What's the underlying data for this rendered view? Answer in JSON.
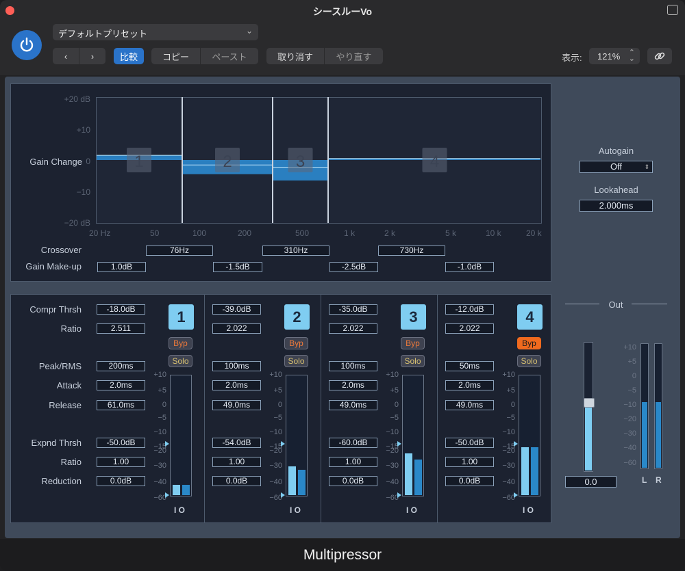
{
  "window": {
    "title": "シースルーVo"
  },
  "header": {
    "preset": "デフォルトプリセット",
    "compare_label": "比較",
    "copy_label": "コピー",
    "paste_label": "ペースト",
    "undo_label": "取り消す",
    "redo_label": "やり直す",
    "view_label": "表示:",
    "zoom": "121%"
  },
  "graph": {
    "ylabel": "Gain Change",
    "y_ticks": [
      "+20 dB",
      "+10",
      "0",
      "−10",
      "−20 dB"
    ],
    "x_ticks": [
      "20 Hz",
      "50",
      "100",
      "200",
      "500",
      "1 k",
      "2 k",
      "5 k",
      "10 k",
      "20 k"
    ],
    "band_gain_db": [
      1.5,
      -4.5,
      -6.5,
      0.5
    ],
    "band_labels": [
      "1",
      "2",
      "3",
      "4"
    ]
  },
  "crossover": {
    "label": "Crossover",
    "values": [
      "76Hz",
      "310Hz",
      "730Hz"
    ]
  },
  "gain_makeup": {
    "label": "Gain Make-up",
    "values": [
      "1.0dB",
      "-1.5dB",
      "-2.5dB",
      "-1.0dB"
    ]
  },
  "side": {
    "autogain_label": "Autogain",
    "autogain_value": "Off",
    "lookahead_label": "Lookahead",
    "lookahead_value": "2.000ms"
  },
  "row_labels": {
    "compr_thrsh": "Compr Thrsh",
    "ratio": "Ratio",
    "peak_rms": "Peak/RMS",
    "attack": "Attack",
    "release": "Release",
    "expnd_thrsh": "Expnd Thrsh",
    "ratio2": "Ratio",
    "reduction": "Reduction"
  },
  "bands": [
    {
      "num": "1",
      "compr_thrsh": "-18.0dB",
      "ratio": "2.511",
      "peak_rms": "200ms",
      "attack": "2.0ms",
      "release": "61.0ms",
      "expnd_thrsh": "-50.0dB",
      "expnd_ratio": "1.00",
      "reduction": "0.0dB",
      "byp": "Byp",
      "solo": "Solo",
      "byp_on": false,
      "meter_in_db": -44,
      "meter_out_db": -44
    },
    {
      "num": "2",
      "compr_thrsh": "-39.0dB",
      "ratio": "2.022",
      "peak_rms": "100ms",
      "attack": "2.0ms",
      "release": "49.0ms",
      "expnd_thrsh": "-54.0dB",
      "expnd_ratio": "1.00",
      "reduction": "0.0dB",
      "byp": "Byp",
      "solo": "Solo",
      "byp_on": false,
      "meter_in_db": -31,
      "meter_out_db": -33
    },
    {
      "num": "3",
      "compr_thrsh": "-35.0dB",
      "ratio": "2.022",
      "peak_rms": "100ms",
      "attack": "2.0ms",
      "release": "49.0ms",
      "expnd_thrsh": "-60.0dB",
      "expnd_ratio": "1.00",
      "reduction": "0.0dB",
      "byp": "Byp",
      "solo": "Solo",
      "byp_on": false,
      "meter_in_db": -22,
      "meter_out_db": -26
    },
    {
      "num": "4",
      "compr_thrsh": "-12.0dB",
      "ratio": "2.022",
      "peak_rms": "50ms",
      "attack": "2.0ms",
      "release": "49.0ms",
      "expnd_thrsh": "-50.0dB",
      "expnd_ratio": "1.00",
      "reduction": "0.0dB",
      "byp": "Byp",
      "solo": "Solo",
      "byp_on": true,
      "meter_in_db": -15,
      "meter_out_db": -15
    }
  ],
  "meter_scale": [
    "+10",
    "+5",
    "0",
    "−5",
    "−10",
    "−15",
    "−20",
    "−30",
    "−40",
    "−60"
  ],
  "io_label": "I O",
  "out": {
    "label": "Out",
    "value": "0.0",
    "scale": [
      "+10",
      "+5",
      "0",
      "−5",
      "−10",
      "−20",
      "−30",
      "−40",
      "−60"
    ],
    "left_label": "L",
    "right_label": "R",
    "level_l_db": -10,
    "level_r_db": -10
  },
  "footer": {
    "title": "Multipressor"
  }
}
